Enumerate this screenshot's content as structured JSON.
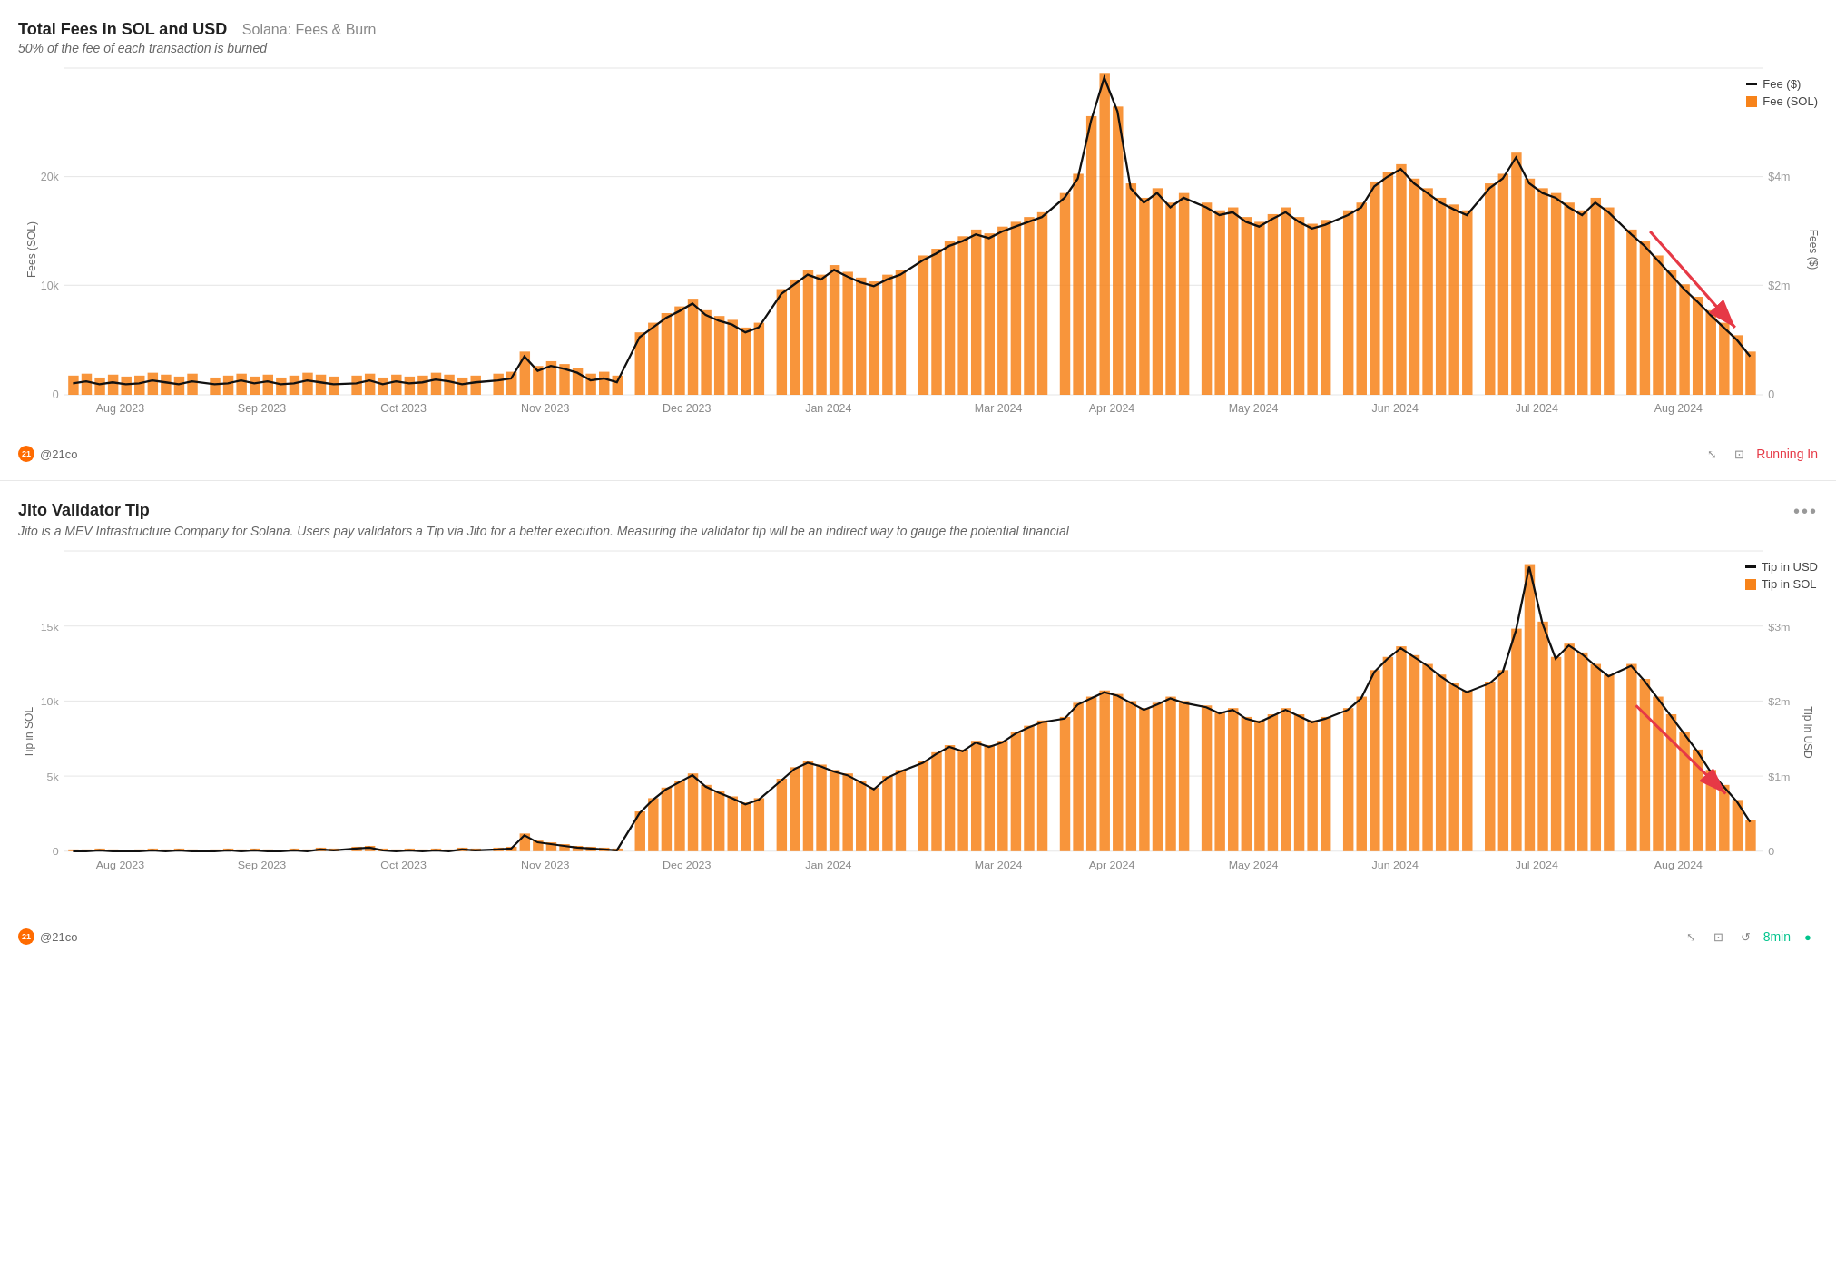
{
  "chart1": {
    "title": "Total Fees in SOL and USD",
    "subtitle_inline": "Solana: Fees & Burn",
    "subtitle": "50% of the fee of each transaction is burned",
    "y_axis_left": "Fees (SOL)",
    "y_axis_right": "Fees ($)",
    "y_left_labels": [
      "0",
      "10k",
      "20k"
    ],
    "y_right_labels": [
      "0",
      "$2m",
      "$4m"
    ],
    "x_labels": [
      "Aug 2023",
      "Sep 2023",
      "Oct 2023",
      "Nov 2023",
      "Dec 2023",
      "Jan 2024",
      "Mar 2024",
      "Apr 2024",
      "May 2024",
      "Jun 2024",
      "Jul 2024",
      "Aug 2024"
    ],
    "legend": [
      {
        "label": "Fee ($)",
        "type": "line"
      },
      {
        "label": "Fee (SOL)",
        "type": "bar"
      }
    ],
    "attribution": "@21co",
    "status": "Running In",
    "status_color": "#e63946"
  },
  "chart2": {
    "title": "Jito Validator Tip",
    "subtitle": "Jito is a MEV Infrastructure Company for Solana. Users pay validators a Tip via Jito for a better execution. Measuring the validator tip will be an indirect way to gauge the potential financial",
    "y_axis_left": "Tip in SOL",
    "y_axis_right": "Tip in USD",
    "y_left_labels": [
      "0",
      "5k",
      "10k",
      "15k"
    ],
    "y_right_labels": [
      "0",
      "$1m",
      "$2m",
      "$3m"
    ],
    "x_labels": [
      "Aug 2023",
      "Sep 2023",
      "Oct 2023",
      "Nov 2023",
      "Dec 2023",
      "Jan 2024",
      "Mar 2024",
      "Apr 2024",
      "May 2024",
      "Jun 2024",
      "Jul 2024",
      "Aug 2024"
    ],
    "legend": [
      {
        "label": "Tip in USD",
        "type": "line"
      },
      {
        "label": "Tip in SOL",
        "type": "bar"
      }
    ],
    "attribution": "@21co",
    "status": "8min",
    "status_color": "#00c48c"
  }
}
